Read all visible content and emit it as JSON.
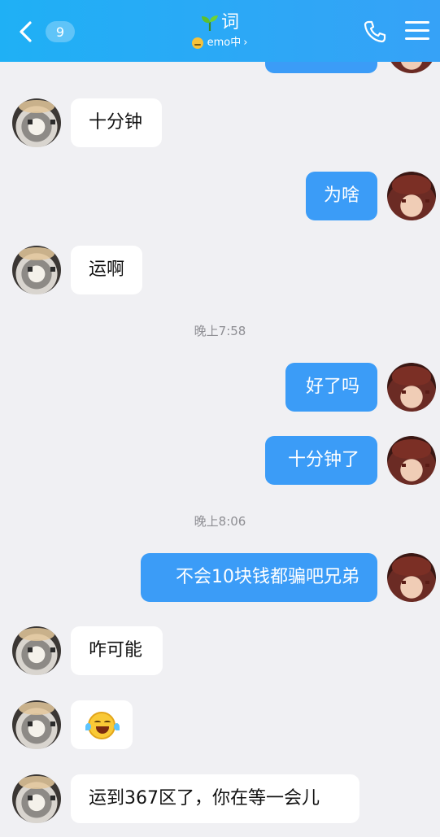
{
  "header": {
    "unread_count": "9",
    "contact_name": "词",
    "status_text": "emo中",
    "status_chevron": "›",
    "icons": [
      "back-icon",
      "sprout-icon",
      "emo-status-icon",
      "phone-icon",
      "menu-icon"
    ]
  },
  "messages": [
    {
      "side": "in",
      "text": "十分钟"
    },
    {
      "side": "out",
      "text": "为啥"
    },
    {
      "side": "in",
      "text": "运啊"
    },
    {
      "timestamp": "晚上7:58"
    },
    {
      "side": "out",
      "text": "好了吗"
    },
    {
      "side": "out",
      "text": "十分钟了"
    },
    {
      "timestamp": "晚上8:06"
    },
    {
      "side": "out",
      "text": "不会10块钱都骗吧兄弟"
    },
    {
      "side": "in",
      "text": "咋可能"
    },
    {
      "side": "in",
      "emoji": "laughing-tears-emoji"
    },
    {
      "side": "in",
      "text": "运到367区了，你在等一会儿"
    }
  ],
  "colors": {
    "header_start": "#1fb0f5",
    "header_end": "#36a2f7",
    "outgoing_bubble": "#3b9cf7",
    "incoming_bubble": "#ffffff",
    "background": "#f0f0f3",
    "timestamp": "#8e8e93"
  }
}
